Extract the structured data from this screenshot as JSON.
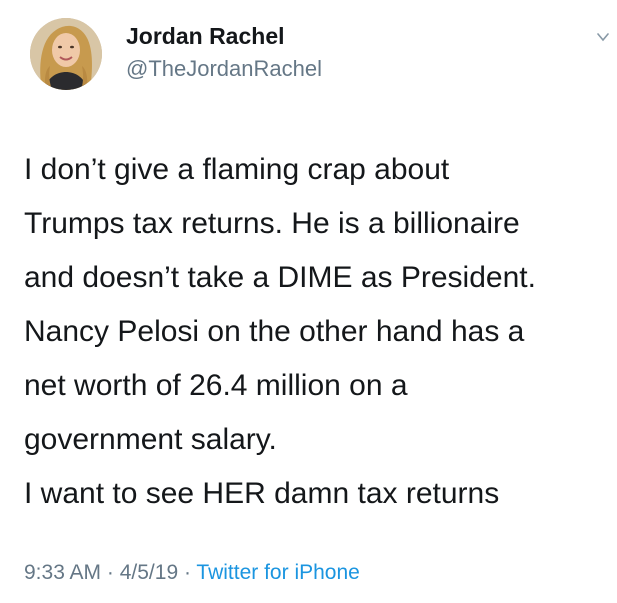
{
  "tweet": {
    "display_name": "Jordan Rachel",
    "handle": "@TheJordanRachel",
    "lines": [
      "I don’t give a flaming crap about",
      "Trumps tax returns. He is a billionaire",
      "and doesn’t take a DIME as President.",
      "Nancy Pelosi on the other hand has a",
      "net worth of 26.4 million on a",
      "government salary.",
      "I want to see HER damn tax returns"
    ],
    "time": "9:33 AM",
    "separator": " · ",
    "date": "4/5/19",
    "source": "Twitter for iPhone"
  },
  "icons": {
    "caret": "chevron-down-icon",
    "avatar": "profile-photo"
  },
  "colors": {
    "text": "#14171a",
    "secondary": "#657786",
    "link": "#1b95e0",
    "background": "#ffffff"
  }
}
